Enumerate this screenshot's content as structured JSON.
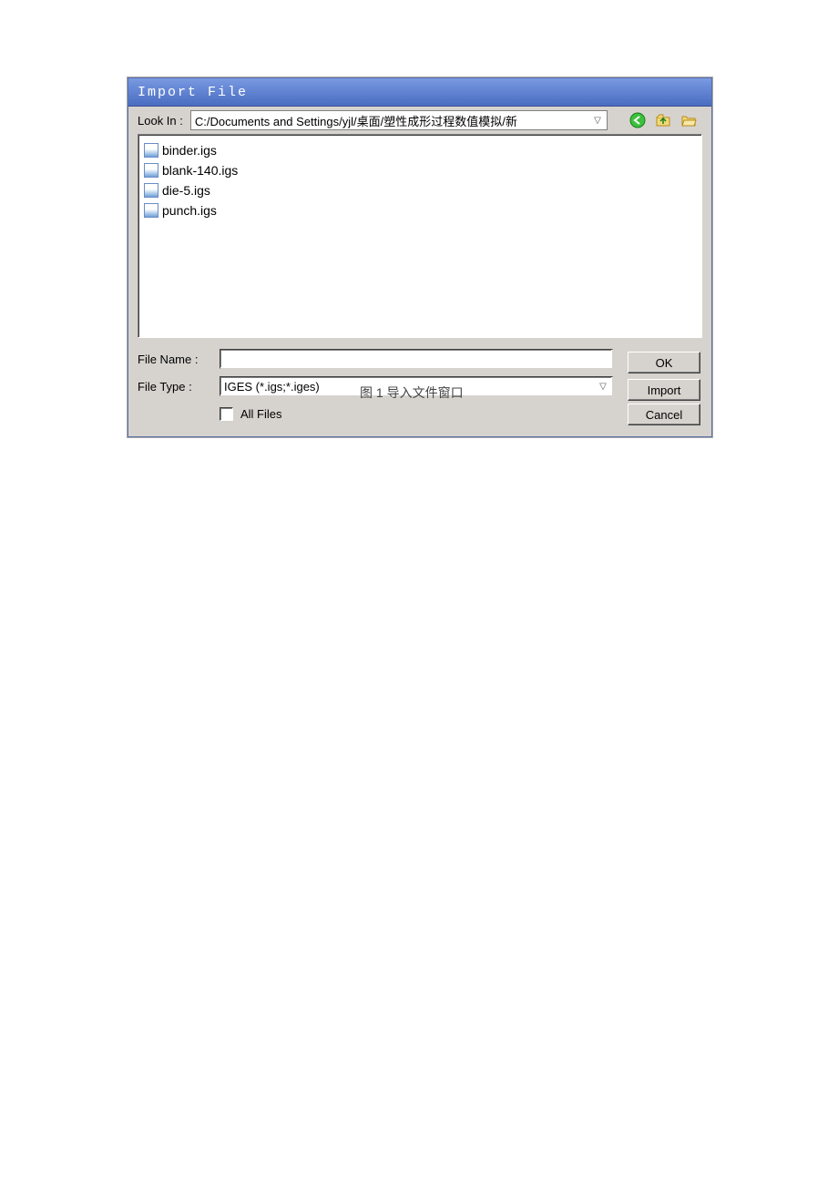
{
  "dialog": {
    "title": "Import File",
    "look_in_label": "Look In :",
    "look_in_path": "C:/Documents and Settings/yjl/桌面/塑性成形过程数值模拟/新",
    "file_list": [
      "binder.igs",
      "blank-140.igs",
      "die-5.igs",
      "punch.igs"
    ],
    "file_name_label": "File Name :",
    "file_name_value": "",
    "file_type_label": "File Type :",
    "file_type_value": "IGES (*.igs;*.iges)",
    "all_files_label": "All Files",
    "buttons": {
      "ok": "OK",
      "import": "Import",
      "cancel": "Cancel"
    }
  },
  "caption": "图 1 导入文件窗口"
}
